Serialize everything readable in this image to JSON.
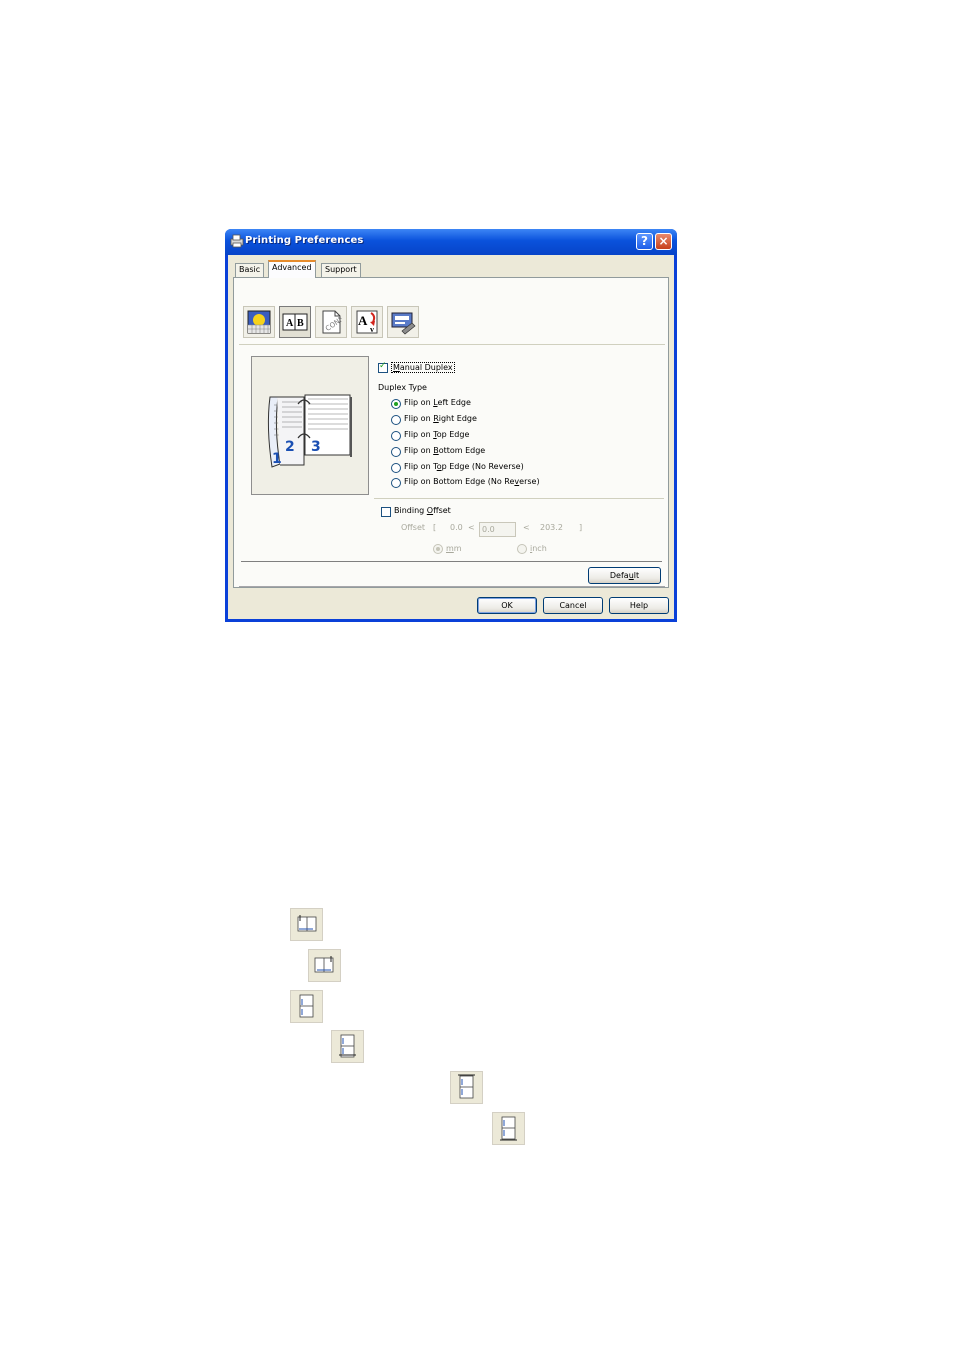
{
  "window": {
    "title": "Printing Preferences",
    "help_glyph": "?",
    "close_glyph": "×"
  },
  "tabs": [
    {
      "label": "Basic",
      "active": false
    },
    {
      "label": "Advanced",
      "active": true
    },
    {
      "label": "Support",
      "active": false
    }
  ],
  "toolbar": {
    "icons": [
      "print-quality-icon",
      "duplex-icon",
      "watermark-icon",
      "page-setting-icon",
      "device-options-icon"
    ],
    "selected": "duplex-icon"
  },
  "preview": {
    "pages": [
      "1",
      "2",
      "3"
    ]
  },
  "manual_duplex": {
    "label_prefix": "",
    "label_ul": "M",
    "label_rest": "anual Duplex",
    "checked": true
  },
  "duplex_type": {
    "heading": "Duplex Type",
    "options": [
      {
        "pre": "Flip on ",
        "ul": "L",
        "post": "eft Edge",
        "selected": true
      },
      {
        "pre": "Flip on ",
        "ul": "R",
        "post": "ight Edge",
        "selected": false
      },
      {
        "pre": "Flip on ",
        "ul": "T",
        "post": "op Edge",
        "selected": false
      },
      {
        "pre": "Flip on ",
        "ul": "B",
        "post": "ottom Edge",
        "selected": false
      },
      {
        "pre": "Flip on T",
        "ul": "o",
        "post": "p Edge (No Reverse)",
        "selected": false
      },
      {
        "pre": "Flip on Bottom Edge (No Re",
        "ul": "v",
        "post": "erse)",
        "selected": false
      }
    ]
  },
  "binding_offset": {
    "label_pre": "Binding ",
    "label_ul": "O",
    "label_post": "ffset",
    "checked": false,
    "offset_label": "Offset",
    "bracket_open": "[",
    "min": "0.0",
    "lt1": "<",
    "value": "0.0",
    "lt2": "<",
    "max": "203.2",
    "bracket_close": "]",
    "unit_mm_ul": "m",
    "unit_mm_rest": "m",
    "unit_inch_ul": "i",
    "unit_inch_rest": "nch",
    "unit_selected": "mm"
  },
  "buttons": {
    "default_pre": "Defa",
    "default_ul": "u",
    "default_post": "lt",
    "ok": "OK",
    "cancel": "Cancel",
    "help": "Help"
  },
  "reference_icons": [
    "flip-left-edge-icon",
    "flip-right-edge-icon",
    "flip-top-edge-icon",
    "flip-bottom-edge-icon",
    "flip-top-edge-no-reverse-icon",
    "flip-bottom-edge-no-reverse-icon"
  ],
  "colors": {
    "titlebar": "#0a52dc",
    "dialog_face": "#ece9d8",
    "radio_check": "#21a121",
    "tab_highlight": "#e68b2c"
  }
}
